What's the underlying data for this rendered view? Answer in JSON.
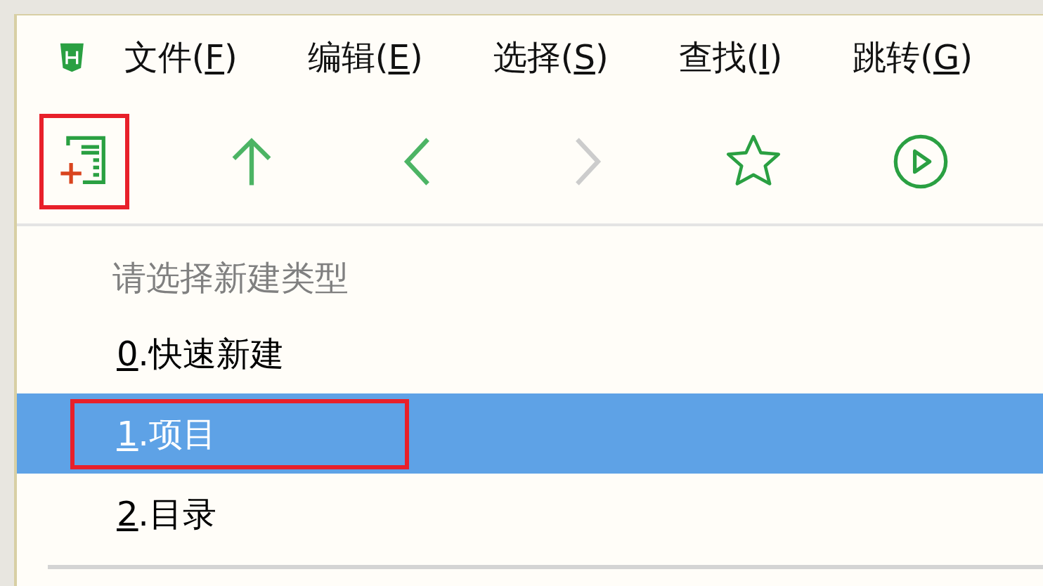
{
  "menu_bar": [
    {
      "before": "文件(",
      "key": "F",
      "after": ")"
    },
    {
      "before": "编辑(",
      "key": "E",
      "after": ")"
    },
    {
      "before": "选择(",
      "key": "S",
      "after": ")"
    },
    {
      "before": "查找(",
      "key": "I",
      "after": ")"
    },
    {
      "before": "跳转(",
      "key": "G",
      "after": ")"
    }
  ],
  "toolbar": [
    {
      "kind": "new",
      "disabled": false,
      "highlighted": true
    },
    {
      "kind": "up",
      "disabled": false,
      "highlighted": false
    },
    {
      "kind": "back",
      "disabled": false,
      "highlighted": false
    },
    {
      "kind": "forward",
      "disabled": true,
      "highlighted": false
    },
    {
      "kind": "star",
      "disabled": false,
      "highlighted": false
    },
    {
      "kind": "run",
      "disabled": false,
      "highlighted": false
    }
  ],
  "dropdown": {
    "title": "请选择新建类型",
    "items": [
      {
        "key": "0",
        "label": ".快速新建",
        "selected": false,
        "highlighted": false
      },
      {
        "key": "1",
        "label": ".项目",
        "selected": true,
        "highlighted": true
      },
      {
        "key": "2",
        "label": ".目录",
        "selected": false,
        "highlighted": false
      }
    ]
  }
}
